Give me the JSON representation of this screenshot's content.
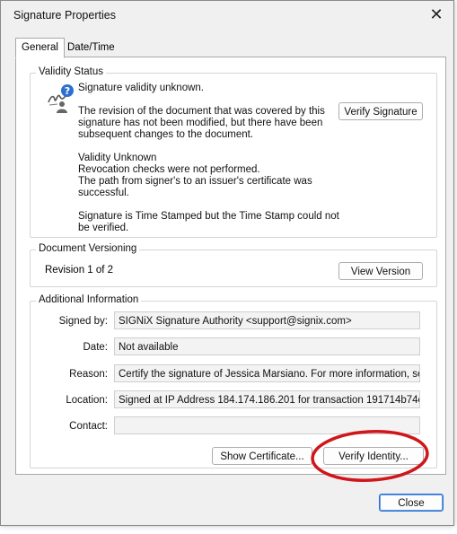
{
  "dialog": {
    "title": "Signature Properties",
    "close_glyph": "✕"
  },
  "tabs": [
    {
      "label": "General",
      "active": true
    },
    {
      "label": "Date/Time",
      "active": false
    }
  ],
  "validity": {
    "group_title": "Validity Status",
    "icon": "signature-unknown-icon",
    "headline": "Signature validity unknown.",
    "para1": [
      "The revision of the document that was covered by this",
      "signature has not been modified, but there have been",
      "subsequent changes to the document."
    ],
    "para2": [
      "Validity Unknown",
      "Revocation checks were not performed.",
      "The path from signer's to an issuer's certificate was",
      "successful."
    ],
    "para3": [
      "Signature is Time Stamped but the Time Stamp could not",
      "be verified."
    ],
    "verify_signature_label": "Verify Signature"
  },
  "versioning": {
    "group_title": "Document Versioning",
    "revision_text": "Revision 1 of 2",
    "view_version_label": "View Version"
  },
  "additional": {
    "group_title": "Additional Information",
    "rows": [
      {
        "label": "Signed by:",
        "value": "SIGNiX Signature Authority <support@signix.com>"
      },
      {
        "label": "Date:",
        "value": "Not available"
      },
      {
        "label": "Reason:",
        "value": "Certify the signature of Jessica  Marsiano. For more information, see h"
      },
      {
        "label": "Location:",
        "value": "Signed at IP Address 184.174.186.201 for transaction 191714b74cf:-"
      },
      {
        "label": "Contact:",
        "value": ""
      }
    ],
    "show_certificate_label": "Show Certificate...",
    "verify_identity_label": "Verify Identity..."
  },
  "footer": {
    "close_label": "Close"
  },
  "colors": {
    "annotation": "#d0161b",
    "primary_border": "#2d6fcf"
  }
}
